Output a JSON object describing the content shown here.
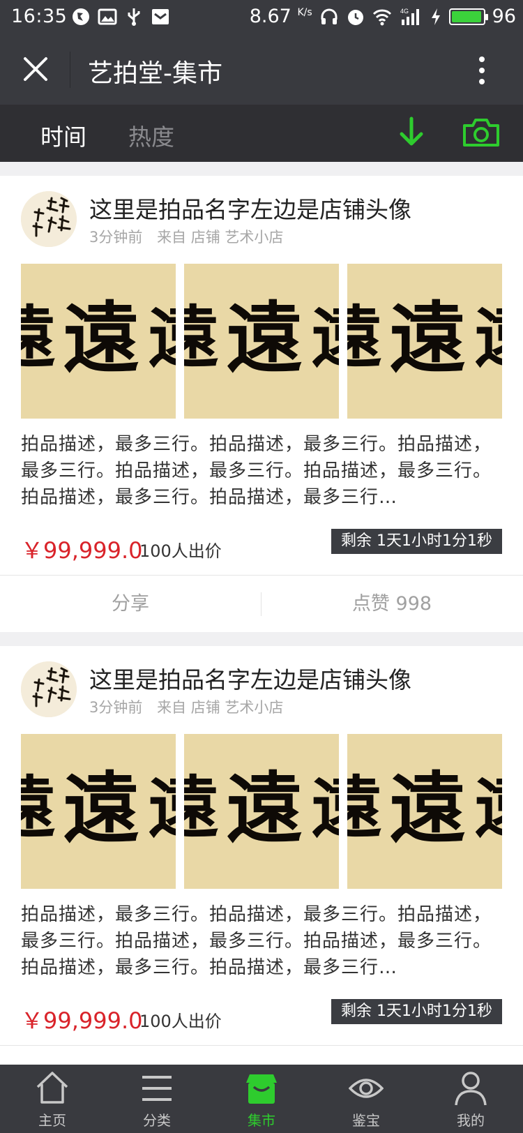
{
  "status_bar": {
    "time": "16:35",
    "speed": "8.67",
    "speed_unit": "K/s",
    "network": "4G",
    "battery": "96",
    "battery_level": 0.96,
    "icons": [
      "location-icon",
      "image-icon",
      "usb-icon",
      "mail-icon",
      "headphones-icon",
      "alarm-icon",
      "wifi-icon",
      "signal-icon",
      "charging-icon",
      "battery-icon"
    ]
  },
  "header": {
    "title": "艺拍堂-集市",
    "close_icon": "close-icon",
    "more_icon": "more-vertical-icon"
  },
  "tabs": {
    "items": [
      {
        "label": "时间",
        "active": true
      },
      {
        "label": "热度",
        "active": false
      }
    ],
    "download_icon": "download-arrow-icon",
    "camera_icon": "camera-icon",
    "accent": "#2ecc2e"
  },
  "feed": [
    {
      "title": "这里是拍品名字左边是店铺头像",
      "time_ago": "3分钟前",
      "from_label": "来自 店铺 艺术小店",
      "image_char": "遠",
      "description": "拍品描述，最多三行。拍品描述，最多三行。拍品描述，最多三行。拍品描述，最多三行。拍品描述，最多三行。拍品描述，最多三行。拍品描述，最多三行…",
      "price": "￥99,999.0",
      "bidders": "100人出价",
      "remaining": "剩余 1天1小时1分1秒",
      "share_label": "分享",
      "like_label": "点赞 998"
    },
    {
      "title": "这里是拍品名字左边是店铺头像",
      "time_ago": "3分钟前",
      "from_label": "来自 店铺 艺术小店",
      "image_char": "遠",
      "description": "拍品描述，最多三行。拍品描述，最多三行。拍品描述，最多三行。拍品描述，最多三行。拍品描述，最多三行。拍品描述，最多三行。拍品描述，最多三行…",
      "price": "￥99,999.0",
      "bidders": "100人出价",
      "remaining": "剩余 1天1小时1分1秒"
    }
  ],
  "bottom_nav": [
    {
      "label": "主页",
      "icon": "home-icon",
      "active": false
    },
    {
      "label": "分类",
      "icon": "menu-icon",
      "active": false
    },
    {
      "label": "集市",
      "icon": "market-icon",
      "active": true
    },
    {
      "label": "鉴宝",
      "icon": "eye-icon",
      "active": false
    },
    {
      "label": "我的",
      "icon": "user-icon",
      "active": false
    }
  ],
  "colors": {
    "bar_dark": "#393a3f",
    "tab_dark": "#2f2f33",
    "price_red": "#d9232a",
    "active_green": "#2ecc2e",
    "page_bg": "#f0f0f2"
  }
}
